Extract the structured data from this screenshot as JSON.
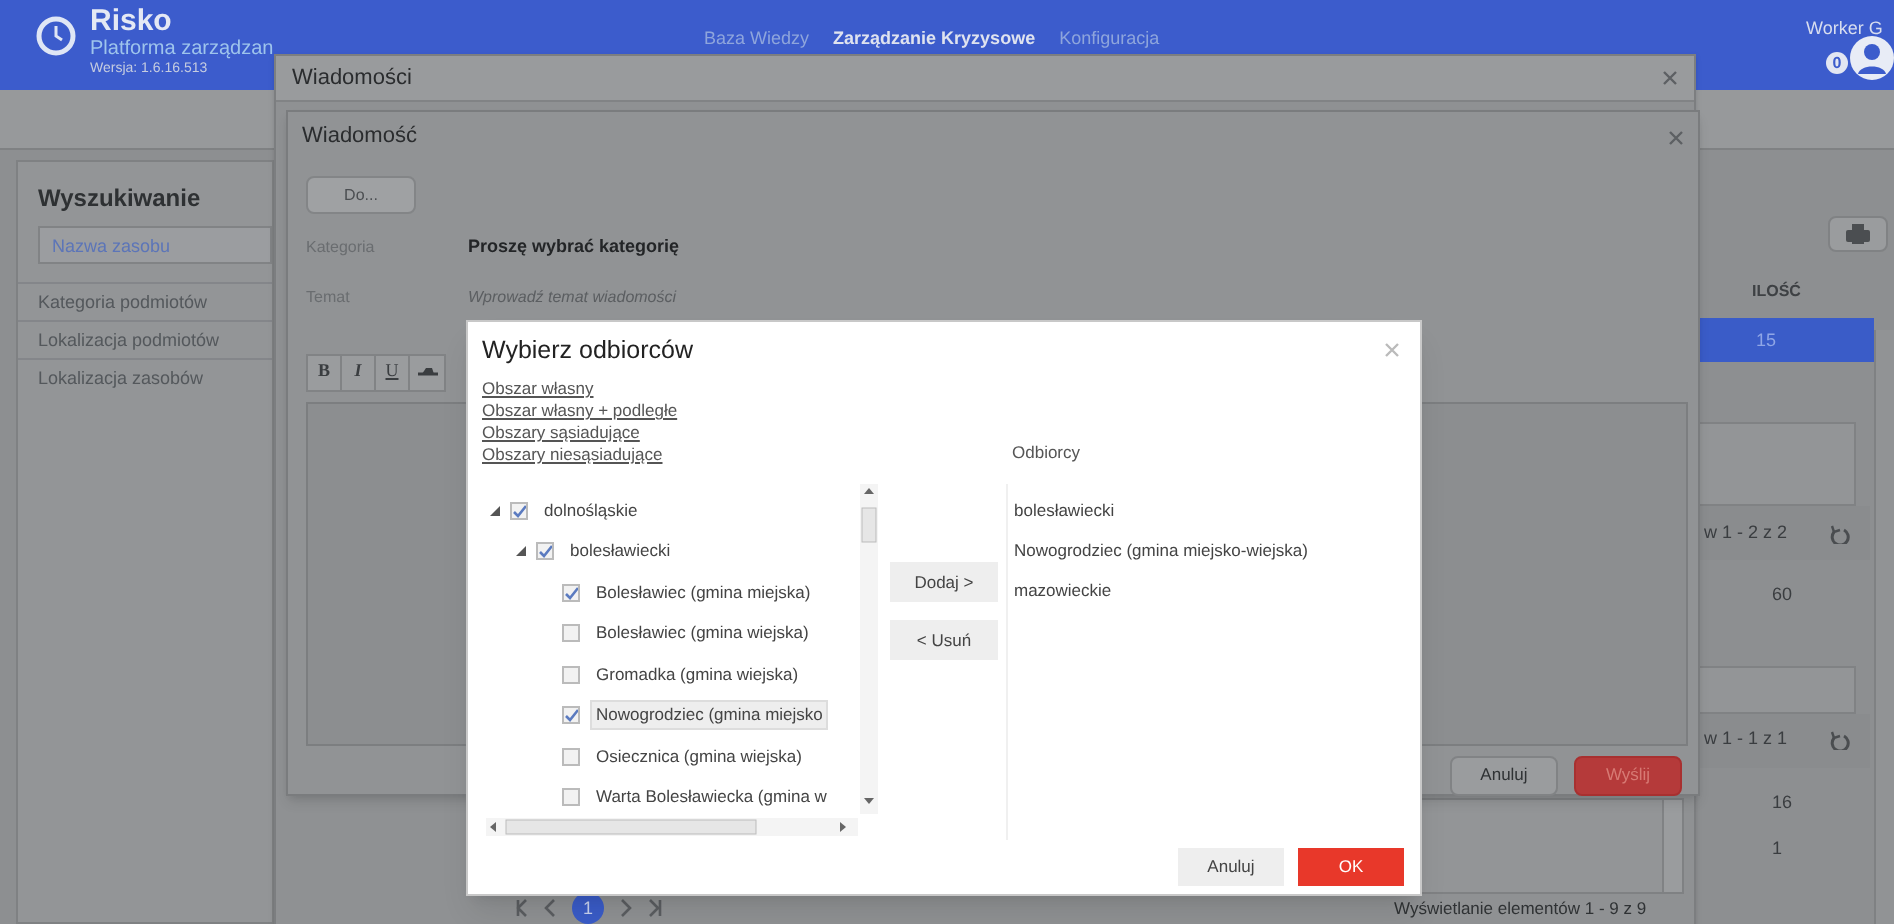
{
  "header": {
    "app_name": "Risko",
    "subtitle": "Platforma zarządzan",
    "version": "Wersja: 1.6.16.513",
    "nav": [
      {
        "label": "Baza Wiedzy",
        "selected": false
      },
      {
        "label": "Zarządzanie Kryzysowe",
        "selected": true
      },
      {
        "label": "Konfiguracja",
        "selected": false
      }
    ],
    "user": "Worker G",
    "badge": "0"
  },
  "search_panel": {
    "title": "Wyszukiwanie",
    "search": {
      "placeholder": "Nazwa zasobu"
    },
    "items": [
      "Kategoria podmiotów",
      "Lokalizacja podmiotów",
      "Lokalizacja zasobów"
    ]
  },
  "main_table": {
    "column": "ILOŚĆ",
    "rows": [
      {
        "value": "15",
        "selected": true
      }
    ],
    "pager_1": "w 1 - 2 z 2",
    "value_2": "60",
    "pager_2": "w 1 - 1 z 1",
    "values_3": [
      "16",
      "1"
    ]
  },
  "messages_window": {
    "title": "Wiadomości",
    "page": "1",
    "footer": "Wyświetlanie elementów 1 - 9 z 9"
  },
  "message_window": {
    "title": "Wiadomość",
    "to_button": "Do...",
    "category_label": "Kategoria",
    "category_value": "Proszę wybrać kategorię",
    "subject_label": "Temat",
    "subject": {
      "placeholder": "Wprowadź temat wiadomości"
    },
    "format_buttons": [
      {
        "label": "B",
        "kind": "bold"
      },
      {
        "label": "I",
        "kind": "italic"
      },
      {
        "label": "U",
        "kind": "underline"
      }
    ],
    "buttons": [
      {
        "label": "Anuluj",
        "kind": "secondary"
      },
      {
        "label": "Wyślij",
        "kind": "primary"
      }
    ]
  },
  "recipients_dialog": {
    "title": "Wybierz odbiorców",
    "links": [
      "Obszar własny",
      "Obszar własny + podległe",
      "Obszary sąsiadujące",
      "Obszary niesąsiadujące"
    ],
    "tree": [
      {
        "label": "dolnośląskie",
        "checked": true,
        "expanded": true,
        "selected": false,
        "children": [
          {
            "label": "bolesławiecki",
            "checked": true,
            "expanded": true,
            "selected": false,
            "children": [
              {
                "label": "Bolesławiec (gmina miejska)",
                "checked": true,
                "selected": false
              },
              {
                "label": "Bolesławiec (gmina wiejska)",
                "checked": false,
                "selected": false
              },
              {
                "label": "Gromadka (gmina wiejska)",
                "checked": false,
                "selected": false
              },
              {
                "label": "Nowogrodziec (gmina miejsko",
                "checked": true,
                "selected": true
              },
              {
                "label": "Osiecznica (gmina wiejska)",
                "checked": false,
                "selected": false
              },
              {
                "label": "Warta Bolesławiecka (gmina w",
                "checked": false,
                "selected": false
              }
            ]
          }
        ]
      }
    ],
    "add_button": "Dodaj >",
    "remove_button": "< Usuń",
    "recipients_label": "Odbiorcy",
    "recipients": [
      "bolesławiecki",
      "Nowogrodziec (gmina miejsko-wiejska)",
      "mazowieckie"
    ],
    "buttons": [
      {
        "label": "Anuluj",
        "kind": "secondary"
      },
      {
        "label": "OK",
        "kind": "primary"
      }
    ]
  }
}
